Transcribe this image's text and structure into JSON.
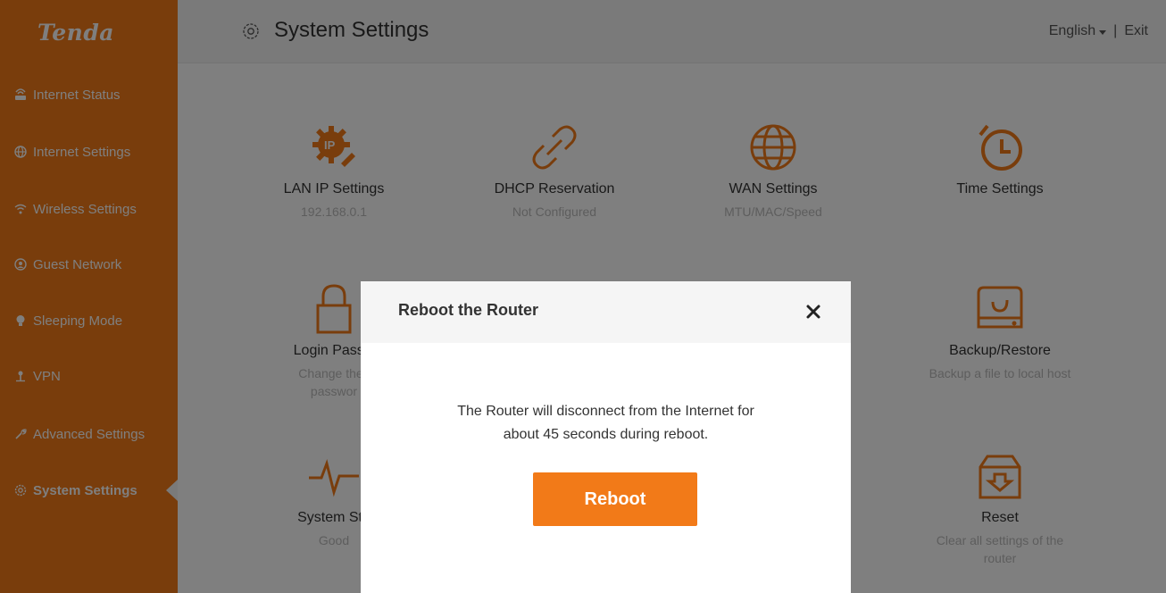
{
  "app": {
    "logo": "Tenda"
  },
  "sidebar": {
    "items": [
      {
        "label": "Internet Status",
        "icon": "router-icon"
      },
      {
        "label": "Internet Settings",
        "icon": "globe-icon"
      },
      {
        "label": "Wireless Settings",
        "icon": "wifi-icon"
      },
      {
        "label": "Guest Network",
        "icon": "guest-icon"
      },
      {
        "label": "Sleeping Mode",
        "icon": "bulb-icon"
      },
      {
        "label": "VPN",
        "icon": "vpn-icon"
      },
      {
        "label": "Advanced Settings",
        "icon": "tools-icon"
      },
      {
        "label": "System Settings",
        "icon": "gear-icon",
        "active": true
      }
    ]
  },
  "header": {
    "title": "System Settings",
    "language": "English",
    "separator": "|",
    "exit": "Exit"
  },
  "tiles": [
    {
      "title": "LAN IP Settings",
      "sub": "192.168.0.1",
      "icon": "ip-gear-icon"
    },
    {
      "title": "DHCP Reservation",
      "sub": "Not Configured",
      "icon": "link-icon"
    },
    {
      "title": "WAN Settings",
      "sub": "MTU/MAC/Speed",
      "icon": "globe-icon"
    },
    {
      "title": "Time Settings",
      "sub": "",
      "icon": "clock-icon"
    },
    {
      "title": "Login Passw",
      "sub": "Change the l",
      "sub2": "passwor",
      "icon": "lock-icon"
    },
    {
      "title": "Backup/Restore",
      "sub": "Backup a file to local host",
      "icon": "backup-drive-icon"
    },
    {
      "title": "System Sta",
      "sub": "Good",
      "icon": "pulse-icon"
    },
    {
      "title": "Reset",
      "sub": "Clear all settings of the",
      "sub2": "router",
      "icon": "reset-box-icon"
    }
  ],
  "modal": {
    "title": "Reboot the Router",
    "message_line1": "The Router will disconnect from the Internet for",
    "message_line2": "about 45 seconds during reboot.",
    "button": "Reboot"
  },
  "colors": {
    "accent": "#f27a18",
    "overlay": "rgba(0,0,0,0.5)"
  }
}
